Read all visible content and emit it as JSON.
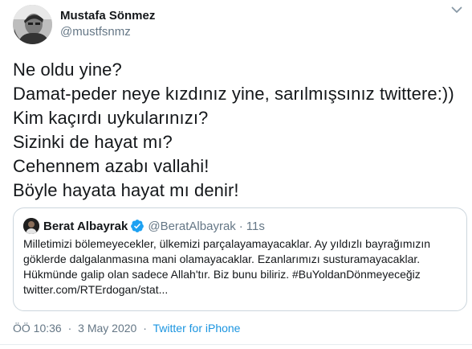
{
  "tweet": {
    "author": {
      "name": "Mustafa Sönmez",
      "handle": "@mustfsnmz"
    },
    "text_lines": [
      "Ne oldu yine?",
      "Damat-peder neye kızdınız yine, sarılmışsınız twittere:))",
      "Kim kaçırdı uykularınızı?",
      "Sizinki de hayat mı?",
      "Cehennem azabı vallahi!",
      "Böyle hayata hayat mı denir!"
    ],
    "quoted": {
      "name": "Berat Albayrak",
      "handle": "@BeratAlbayrak",
      "dot": "·",
      "time": "11s",
      "text_lines": [
        "Milletimizi bölemeyecekler, ülkemizi parçalayamayacaklar. Ay yıldızlı bayrağımızın",
        "göklerde dalgalanmasına mani olamayacaklar. Ezanlarımızı susturamayacaklar.",
        "Hükmünde galip olan sadece Allah'tır. Biz bunu biliriz. #BuYoldanDönmeyeceğiz",
        "twitter.com/RTErdogan/stat..."
      ]
    },
    "meta": {
      "time": "ÖÖ 10:36",
      "date": "3 May 2020",
      "sep": "·",
      "source": "Twitter for iPhone"
    }
  },
  "icons": {
    "menu": "chevron-down-icon",
    "verified": "verified-badge-icon"
  },
  "colors": {
    "accent": "#1b95e0",
    "verified": "#1da1f2",
    "secondary_text": "#657786",
    "border": "#ccd6dd"
  }
}
